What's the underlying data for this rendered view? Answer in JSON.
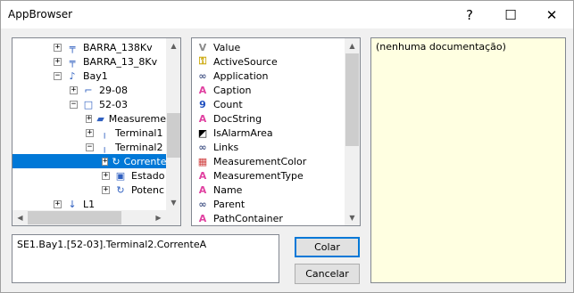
{
  "window": {
    "title": "AppBrowser"
  },
  "titlebar": {
    "help_glyph": "?",
    "maximize_glyph": "☐",
    "close_glyph": "✕"
  },
  "tree": {
    "items": [
      {
        "label": "BARRA_138Kv",
        "expander": "+",
        "icon": "bus-icon"
      },
      {
        "label": "BARRA_13_8Kv",
        "expander": "+",
        "icon": "bus-icon"
      },
      {
        "label": "Bay1",
        "expander": "−",
        "icon": "bay-icon"
      },
      {
        "label": "29-08",
        "expander": "+",
        "icon": "switch-icon"
      },
      {
        "label": "52-03",
        "expander": "−",
        "icon": "breaker-icon"
      },
      {
        "label": "Measureme",
        "expander": "+",
        "icon": "folder-measurement-icon"
      },
      {
        "label": "Terminal1",
        "expander": "+",
        "icon": "terminal-icon"
      },
      {
        "label": "Terminal2",
        "expander": "−",
        "icon": "terminal-icon"
      },
      {
        "label": "Corrente",
        "expander": "+",
        "icon": "analog-measurement-icon"
      },
      {
        "label": "Estado",
        "expander": "+",
        "icon": "digital-measurement-icon"
      },
      {
        "label": "Potenc",
        "expander": "+",
        "icon": "analog-measurement-icon"
      },
      {
        "label": "L1",
        "expander": "+",
        "icon": "load-icon"
      }
    ]
  },
  "members": {
    "items": [
      {
        "label": "Value",
        "icon": "value-icon",
        "glyph": "V",
        "color": "#8a8a8a"
      },
      {
        "label": "ActiveSource",
        "icon": "key-icon",
        "glyph": "⚿",
        "color": "#c9a400"
      },
      {
        "label": "Application",
        "icon": "link-icon",
        "glyph": "∞",
        "color": "#4a5a8a"
      },
      {
        "label": "Caption",
        "icon": "text-icon",
        "glyph": "A",
        "color": "#e040a0"
      },
      {
        "label": "Count",
        "icon": "number-icon",
        "glyph": "9",
        "color": "#2050c0"
      },
      {
        "label": "DocString",
        "icon": "text-icon",
        "glyph": "A",
        "color": "#e040a0"
      },
      {
        "label": "IsAlarmArea",
        "icon": "boolean-icon",
        "glyph": "◩",
        "color": "#000000"
      },
      {
        "label": "Links",
        "icon": "link-icon",
        "glyph": "∞",
        "color": "#4a5a8a"
      },
      {
        "label": "MeasurementColor",
        "icon": "color-icon",
        "glyph": "▦",
        "color": "#d04040"
      },
      {
        "label": "MeasurementType",
        "icon": "text-icon",
        "glyph": "A",
        "color": "#e040a0"
      },
      {
        "label": "Name",
        "icon": "text-icon",
        "glyph": "A",
        "color": "#e040a0"
      },
      {
        "label": "Parent",
        "icon": "link-icon",
        "glyph": "∞",
        "color": "#4a5a8a"
      },
      {
        "label": "PathContainer",
        "icon": "text-icon",
        "glyph": "A",
        "color": "#e040a0"
      }
    ]
  },
  "doc": {
    "text": "(nenhuma documentação)"
  },
  "path": {
    "value": "SE1.Bay1.[52-03].Terminal2.CorrenteA"
  },
  "buttons": {
    "ok": "Colar",
    "cancel": "Cancelar"
  },
  "colors": {
    "selection": "#0078d7",
    "doc_background": "#ffffe1"
  }
}
